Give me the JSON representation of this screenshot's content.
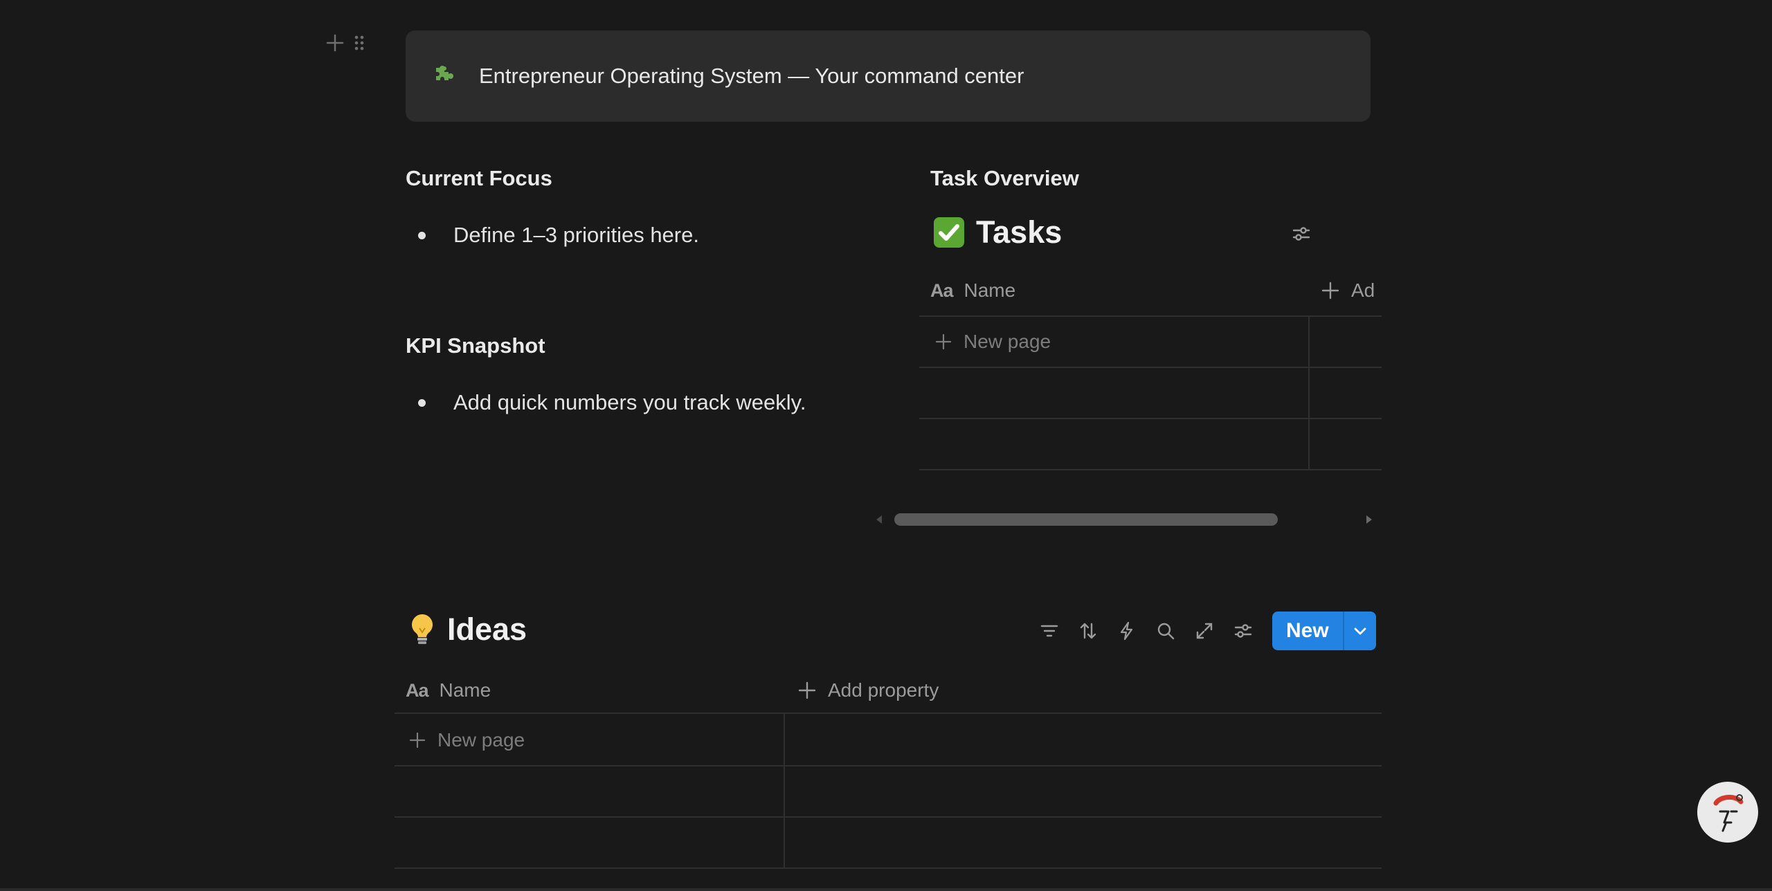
{
  "callout": {
    "icon": "puzzle-piece-icon",
    "icon_color": "#6aa84f",
    "text": "Entrepreneur Operating System — Your command center"
  },
  "current_focus": {
    "heading": "Current Focus",
    "items": [
      "Define 1–3 priorities here."
    ]
  },
  "kpi_snapshot": {
    "heading": "KPI Snapshot",
    "items": [
      "Add quick numbers you track weekly."
    ]
  },
  "task_overview": {
    "heading": "Task Overview",
    "db_icon": "✅",
    "db_title": "Tasks",
    "columns": [
      {
        "icon": "Aa",
        "label": "Name"
      },
      {
        "icon": "+",
        "label": "Ad"
      }
    ],
    "new_page": "New page"
  },
  "ideas": {
    "db_icon": "💡",
    "db_title": "Ideas",
    "toolbar": [
      "filter-icon",
      "sort-icon",
      "automation-icon",
      "search-icon",
      "expand-icon",
      "settings-icon"
    ],
    "new_button": "New",
    "columns": [
      {
        "icon": "Aa",
        "label": "Name"
      },
      {
        "icon": "+",
        "label": "Add property"
      }
    ],
    "new_page": "New page"
  },
  "colors": {
    "background": "#191919",
    "callout_bg": "#2c2c2c",
    "accent": "#2383e2"
  }
}
